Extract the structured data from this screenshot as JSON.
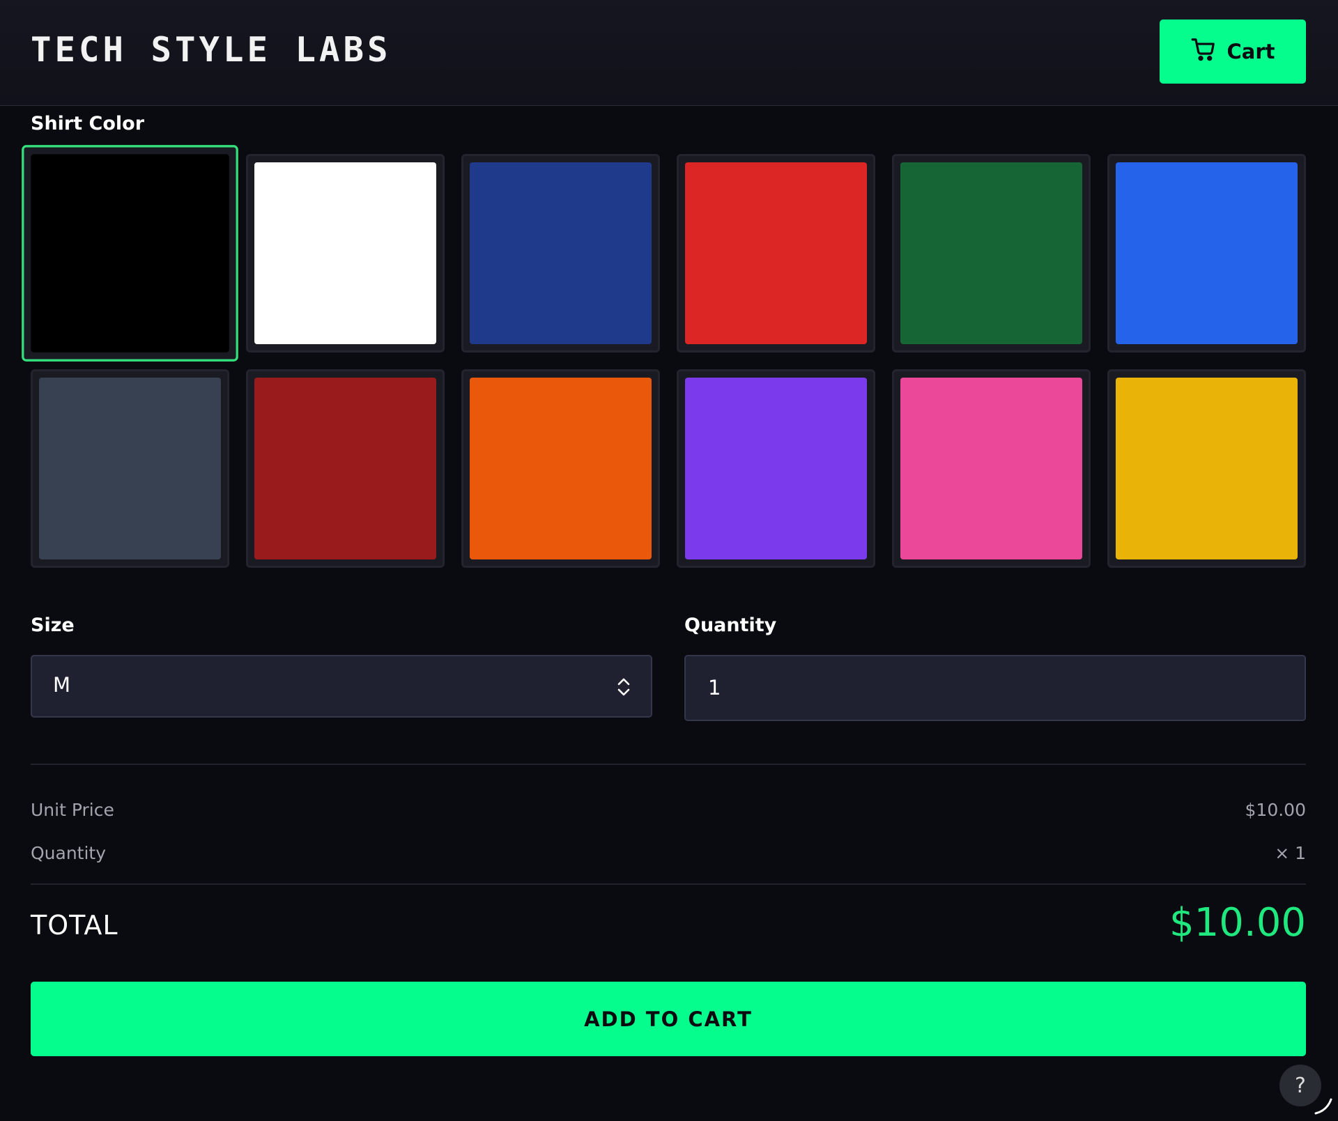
{
  "header": {
    "brand": "TECH STYLE LABS",
    "cart_label": "Cart",
    "cart_icon": "cart-icon"
  },
  "colors_section": {
    "label": "Shirt Color",
    "selected_index": 0,
    "swatches": [
      {
        "color": "#000000"
      },
      {
        "color": "#ffffff"
      },
      {
        "color": "#203a8b"
      },
      {
        "color": "#dc2626"
      },
      {
        "color": "#166534"
      },
      {
        "color": "#2563eb"
      },
      {
        "color": "#374151"
      },
      {
        "color": "#991b1b"
      },
      {
        "color": "#ea580c"
      },
      {
        "color": "#7c3aed"
      },
      {
        "color": "#ec4899"
      },
      {
        "color": "#eab308"
      }
    ]
  },
  "size": {
    "label": "Size",
    "value": "M",
    "icon": "select-arrows-icon"
  },
  "quantity": {
    "label": "Quantity",
    "value": "1"
  },
  "summary": {
    "unit_price_label": "Unit Price",
    "unit_price_value": "$10.00",
    "quantity_label": "Quantity",
    "quantity_value": "× 1",
    "total_label": "TOTAL",
    "total_value": "$10.00"
  },
  "actions": {
    "add_to_cart": "ADD TO CART",
    "help": "?"
  },
  "theme": {
    "accent": "#05fd8e",
    "total_color": "#1fe87e",
    "background": "#0a0b10",
    "selected_border": "#33e07c"
  }
}
